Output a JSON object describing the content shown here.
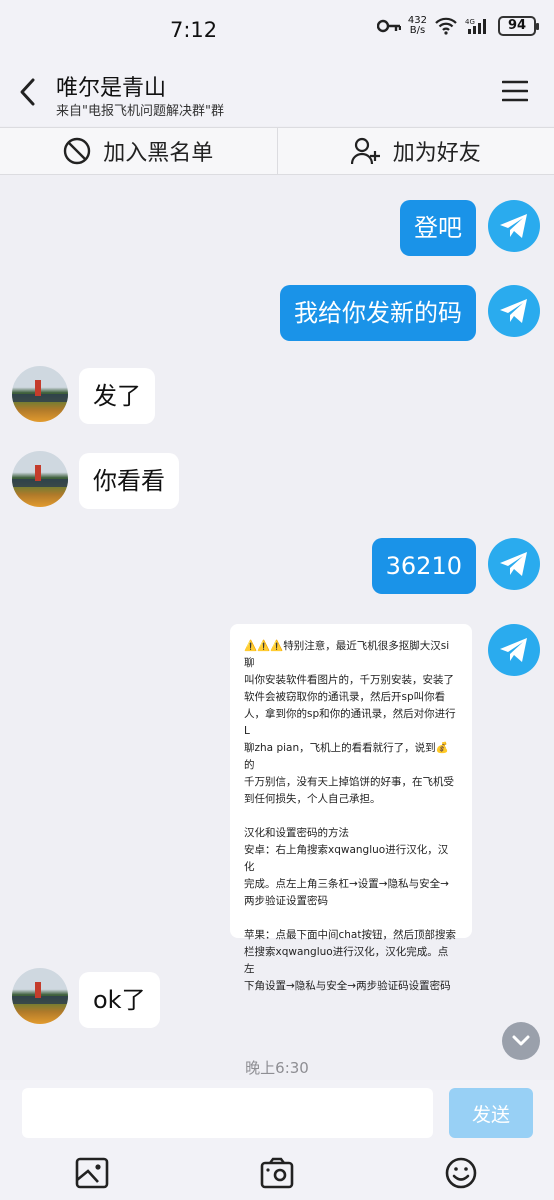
{
  "status": {
    "time": "7:12",
    "net_speed_value": "432",
    "net_speed_unit": "B/s",
    "battery": "94"
  },
  "header": {
    "title": "唯尔是青山",
    "subtitle": "来自\"电报飞机问题解决群\"群"
  },
  "actions": {
    "blacklist": "加入黑名单",
    "add_friend": "加为好友"
  },
  "messages": [
    {
      "side": "out",
      "text": "登吧"
    },
    {
      "side": "out",
      "text": "我给你发新的码"
    },
    {
      "side": "in",
      "text": "发了"
    },
    {
      "side": "in",
      "text": "你看看"
    },
    {
      "side": "out",
      "text": "36210"
    },
    {
      "side": "out",
      "type": "image",
      "lines": [
        "⚠️⚠️⚠️特别注意，最近飞机很多抠脚大汉si聊",
        "叫你安装软件看图片的，千万别安装，安装了",
        "软件会被窃取你的通讯录，然后开sp叫你看",
        "人，拿到你的sp和你的通讯录，然后对你进行L",
        "聊zha pian，飞机上的看看就行了，说到💰的",
        "千万别信，没有天上掉馅饼的好事，在飞机受",
        "到任何损失，个人自己承担。",
        "",
        "汉化和设置密码的方法",
        "安卓：右上角搜索xqwangluo进行汉化，汉化",
        "完成。点左上角三条杠→设置→隐私与安全→",
        "两步验证设置密码",
        "",
        "苹果：点最下面中间chat按钮，然后顶部搜索",
        "栏搜索xqwangluo进行汉化，汉化完成。点左",
        "下角设置→隐私与安全→两步验证码设置密码"
      ]
    },
    {
      "side": "in",
      "text": "ok了"
    }
  ],
  "timestamp": "晚上6:30",
  "composer": {
    "placeholder": "",
    "send_label": "发送"
  },
  "icons": [
    "back-icon",
    "menu-icon",
    "block-icon",
    "add-user-icon",
    "telegram-icon",
    "chevron-down-icon",
    "image-icon",
    "camera-icon",
    "emoji-icon"
  ],
  "colors": {
    "bubble_out": "#1a93e8",
    "bubble_in": "#ffffff",
    "telegram": "#2aabee",
    "send_disabled": "#98d0f5",
    "background": "#efeff4"
  }
}
